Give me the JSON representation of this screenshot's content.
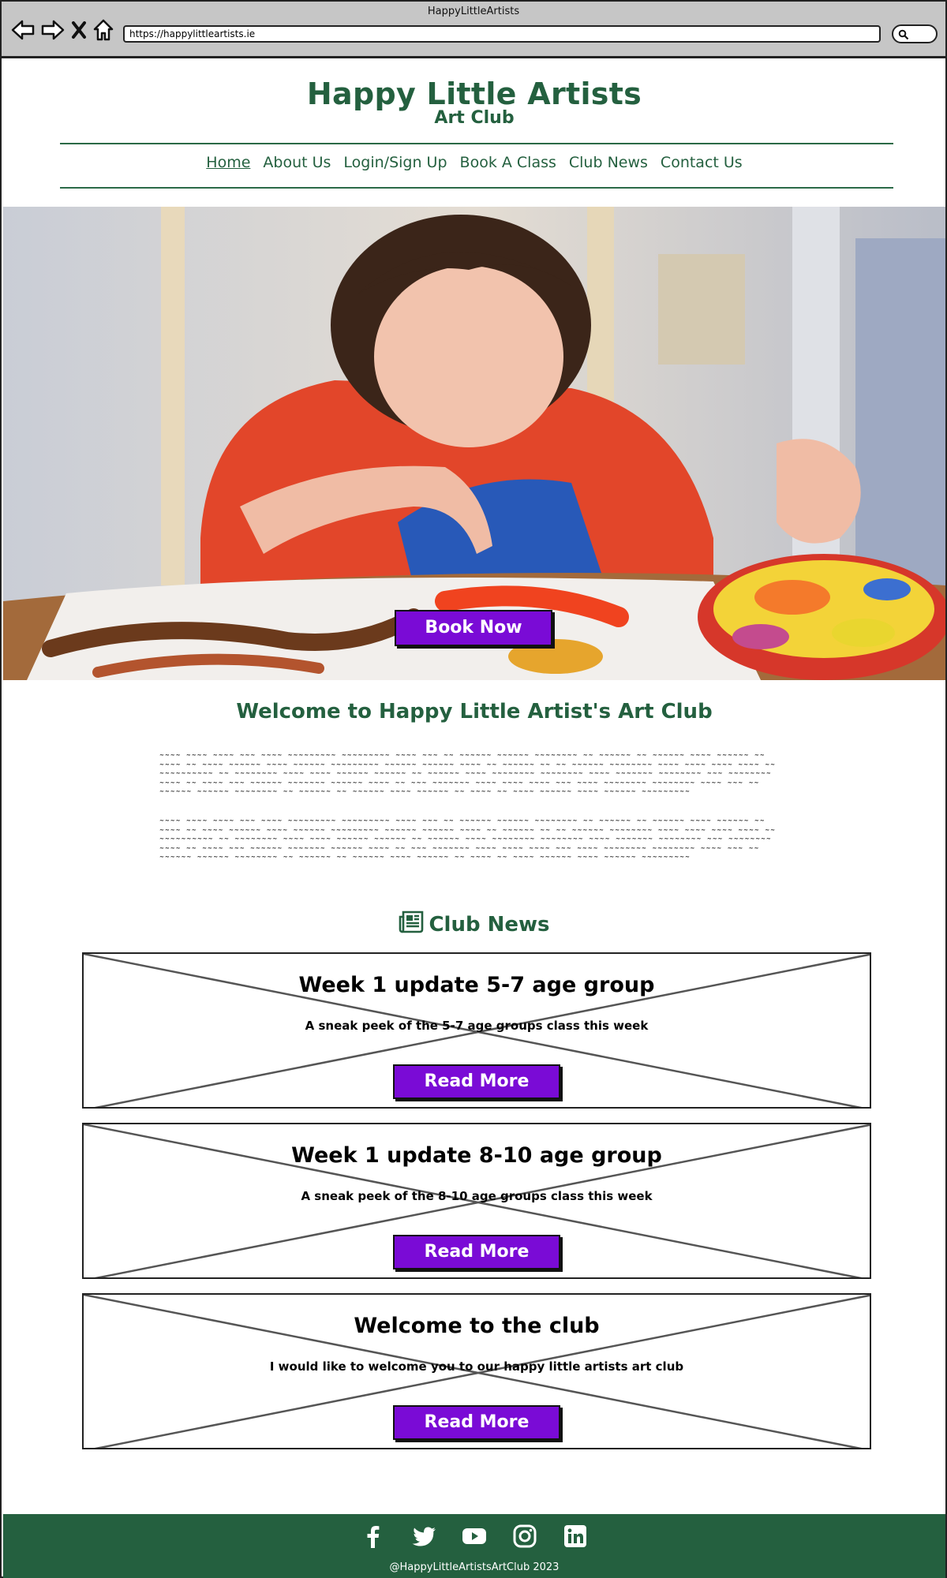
{
  "window": {
    "title": "HappyLittleArtists",
    "url": "https://happylittleartists.ie"
  },
  "site": {
    "title": "Happy Little Artists",
    "subtitle": "Art Club"
  },
  "nav": {
    "items": [
      {
        "label": "Home",
        "active": true
      },
      {
        "label": "About Us",
        "active": false
      },
      {
        "label": "Login/Sign Up",
        "active": false
      },
      {
        "label": "Book A Class",
        "active": false
      },
      {
        "label": "Club News",
        "active": false
      },
      {
        "label": "Contact Us",
        "active": false
      }
    ]
  },
  "hero": {
    "button_label": "Book Now"
  },
  "welcome": {
    "title": "Welcome to Happy Little Artist's Art Club",
    "paragraph_1": "~~~~ ~~~~ ~~~~ ~~~ ~~~~ ~~~~~~~~~ ~~~~~~~~~ ~~~~ ~~~ ~~ ~~~~~~ ~~~~~~ ~~~~~~~~ ~~ ~~~~~~ ~~ ~~~~~~ ~~~~ ~~~~~~ ~~ ~~~~ ~~ ~~~~ ~~~~~~ ~~~~ ~~~~~~ ~~~~~~~~~ ~~~~~~ ~~~~~~ ~~~~ ~~ ~~~~~~ ~~ ~~ ~~~~~~ ~~~~~~~~ ~~~~ ~~~~ ~~~~ ~~~~ ~~ ~~~~~~~~~~ ~~ ~~~~~~~~ ~~~~ ~~~~ ~~~~~~ ~~~~~~ ~~ ~~~~~~ ~~~~ ~~~~~~~~ ~~~~~~~~ ~~~~ ~~~~~~~ ~~~~~~~~ ~~~ ~~~~~~~~ ~~~~ ~~ ~~~~ ~~~ ~~~~~~ ~~~~~~~ ~~~~~~ ~~~~ ~~ ~~~ ~~~~~~~ ~~~~ ~~~~ ~~~~ ~~~ ~~~~ ~~~~~~~~ ~~~~~~~~ ~~~~ ~~~ ~~ ~~~~~~ ~~~~~~ ~~~~~~~~ ~~ ~~~~~~ ~~ ~~~~~~ ~~~~ ~~~~~~ ~~ ~~~~ ~~ ~~~~ ~~~~~~ ~~~~ ~~~~~~ ~~~~~~~~~",
    "paragraph_2": "~~~~ ~~~~ ~~~~ ~~~ ~~~~ ~~~~~~~~~ ~~~~~~~~~ ~~~~ ~~~ ~~ ~~~~~~ ~~~~~~ ~~~~~~~~ ~~ ~~~~~~ ~~ ~~~~~~ ~~~~ ~~~~~~ ~~ ~~~~ ~~ ~~~~ ~~~~~~ ~~~~ ~~~~~~ ~~~~~~~~~ ~~~~~~ ~~~~~~ ~~~~ ~~ ~~~~~~ ~~ ~~ ~~~~~~ ~~~~~~~~ ~~~~ ~~~~ ~~~~ ~~~~ ~~ ~~~~~~~~~~ ~~ ~~~~~~~~ ~~~~ ~~~~ ~~~~~~ ~~~~~~ ~~ ~~~~~~ ~~~~ ~~~~~~~~ ~~~~~~~~ ~~~~ ~~~~~~~ ~~~~~~~~ ~~~ ~~~~~~~~ ~~~~ ~~ ~~~~ ~~~ ~~~~~~ ~~~~~~~ ~~~~~~ ~~~~ ~~ ~~~ ~~~~~~~ ~~~~ ~~~~ ~~~~ ~~~ ~~~~ ~~~~~~~~ ~~~~~~~~ ~~~~ ~~~ ~~ ~~~~~~ ~~~~~~ ~~~~~~~~ ~~ ~~~~~~ ~~ ~~~~~~ ~~~~ ~~~~~~ ~~ ~~~~ ~~ ~~~~ ~~~~~~ ~~~~ ~~~~~~ ~~~~~~~~~"
  },
  "news": {
    "heading": "Club News",
    "icon": "newspaper-icon",
    "cards": [
      {
        "title": "Week 1 update 5-7 age group",
        "description": "A sneak peek of the 5-7 age groups class this week",
        "button_label": "Read More"
      },
      {
        "title": "Week 1 update 8-10 age group",
        "description": "A sneak peek of the 8-10 age groups class this week",
        "button_label": "Read More"
      },
      {
        "title": "Welcome to the club",
        "description": "I would like to welcome you to our happy little artists art club",
        "button_label": "Read More"
      }
    ]
  },
  "footer": {
    "social": [
      "facebook-icon",
      "twitter-icon",
      "youtube-icon",
      "instagram-icon",
      "linkedin-icon"
    ],
    "copyright": "@HappyLittleArtistsArtClub 2023"
  },
  "colors": {
    "brand_green": "#24603f",
    "button_purple": "#7a0bd6",
    "chrome_gray": "#c6c6c6"
  }
}
